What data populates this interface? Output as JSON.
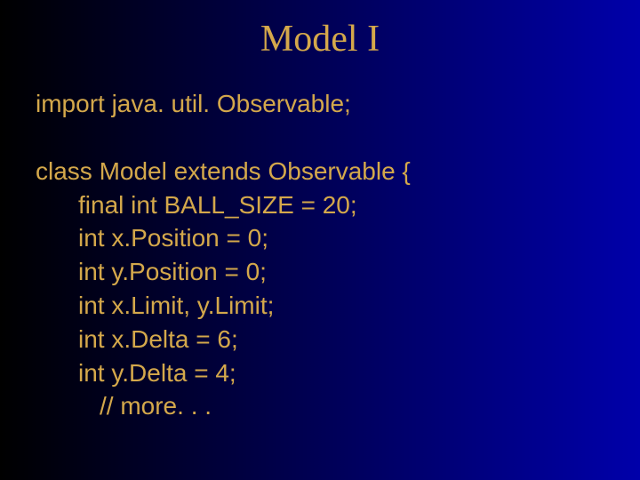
{
  "title": "Model I",
  "code": {
    "import_line": "import java. util. Observable;",
    "class_decl": "class Model extends Observable {",
    "line1": "final int BALL_SIZE = 20;",
    "line2": "int x.Position = 0;",
    "line3": "int y.Position = 0;",
    "line4": "int x.Limit, y.Limit;",
    "line5": "int x.Delta = 6;",
    "line6": "int y.Delta = 4;",
    "comment": "// more. . ."
  }
}
